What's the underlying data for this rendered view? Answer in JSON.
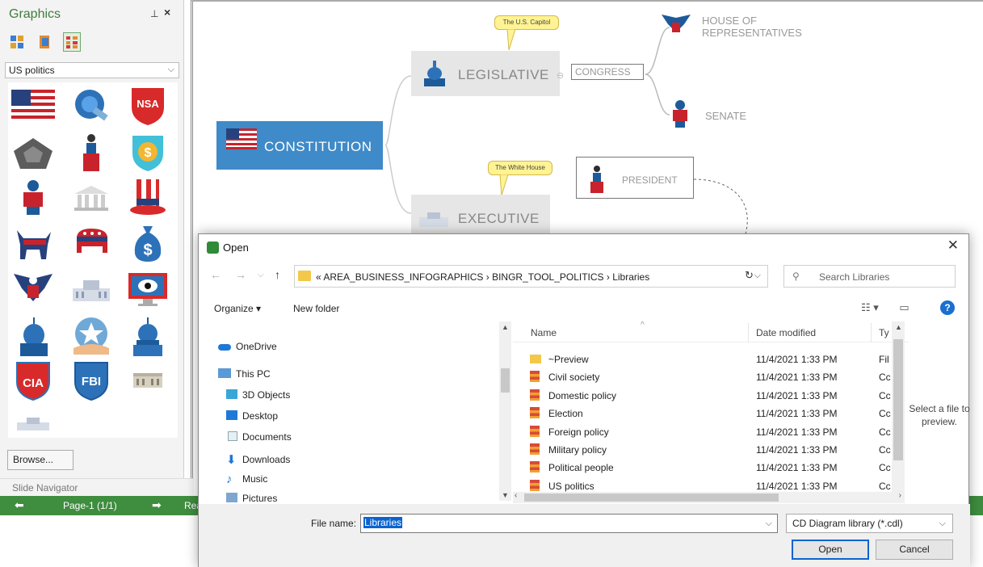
{
  "graphics_panel": {
    "title": "Graphics",
    "pin_glyph": "ᵽ",
    "close_glyph": "×",
    "library_select": "US politics",
    "browse_label": "Browse...",
    "icons": [
      "us-flag-icon",
      "globe-satellite-icon",
      "nsa-shield-icon",
      "pentagon-icon",
      "president-podium-icon",
      "dollar-shield-icon",
      "eagle-seal-icon",
      "supreme-court-icon",
      "uncle-sam-hat-icon",
      "democrat-donkey-icon",
      "republican-elephant-icon",
      "money-bag-icon",
      "eagle-emblem-icon",
      "white-house-icon",
      "surveillance-monitor-icon",
      "capitol-icon",
      "handshake-star-icon",
      "capitol-dome-icon",
      "cia-shield-icon",
      "fbi-shield-icon",
      "government-building-icon",
      "white-house-small-icon"
    ]
  },
  "slide_navigator": {
    "label": "Slide Navigator"
  },
  "status_bar": {
    "page": "Page-1 (1/1)",
    "rest": "Rea"
  },
  "diagram": {
    "root": "CONSTITUTION",
    "legislative": "LEGISLATIVE",
    "legislative_callout": "The U.S. Capitol",
    "congress": "CONGRESS",
    "house": "HOUSE OF",
    "house_line2": "REPRESENTATIVES",
    "senate": "SENATE",
    "executive": "EXECUTIVE",
    "executive_callout": "The White House",
    "president": "PRESIDENT",
    "colors": {
      "root": "#3f8ac8",
      "callout": "#fff394",
      "branch": "#e6e6e6"
    }
  },
  "dialog": {
    "title": "Open",
    "close_glyph": "✕",
    "address_path": "«  AREA_BUSINESS_INFOGRAPHICS  ›  BINGR_TOOL_POLITICS  ›  Libraries",
    "search_placeholder": "Search Libraries",
    "organize": "Organize ▾",
    "new_folder": "New folder",
    "nav_items": [
      "OneDrive",
      "This PC",
      "3D Objects",
      "Desktop",
      "Documents",
      "Downloads",
      "Music",
      "Pictures"
    ],
    "columns": {
      "name": "Name",
      "date": "Date modified",
      "type": "Ty"
    },
    "files": [
      {
        "name": "~Preview",
        "date": "11/4/2021 1:33 PM",
        "type": "Fil",
        "kind": "folder"
      },
      {
        "name": "Civil society",
        "date": "11/4/2021 1:33 PM",
        "type": "Cc",
        "kind": "library"
      },
      {
        "name": "Domestic policy",
        "date": "11/4/2021 1:33 PM",
        "type": "Cc",
        "kind": "library"
      },
      {
        "name": "Election",
        "date": "11/4/2021 1:33 PM",
        "type": "Cc",
        "kind": "library"
      },
      {
        "name": "Foreign policy",
        "date": "11/4/2021 1:33 PM",
        "type": "Cc",
        "kind": "library"
      },
      {
        "name": "Military policy",
        "date": "11/4/2021 1:33 PM",
        "type": "Cc",
        "kind": "library"
      },
      {
        "name": "Political people",
        "date": "11/4/2021 1:33 PM",
        "type": "Cc",
        "kind": "library"
      },
      {
        "name": "US politics",
        "date": "11/4/2021 1:33 PM",
        "type": "Cc",
        "kind": "library"
      }
    ],
    "preview_text": "Select a file to preview.",
    "file_name_label": "File name:",
    "file_name_value": "Libraries",
    "filter": "CD Diagram library (*.cdl)",
    "open_btn": "Open",
    "cancel_btn": "Cancel"
  }
}
